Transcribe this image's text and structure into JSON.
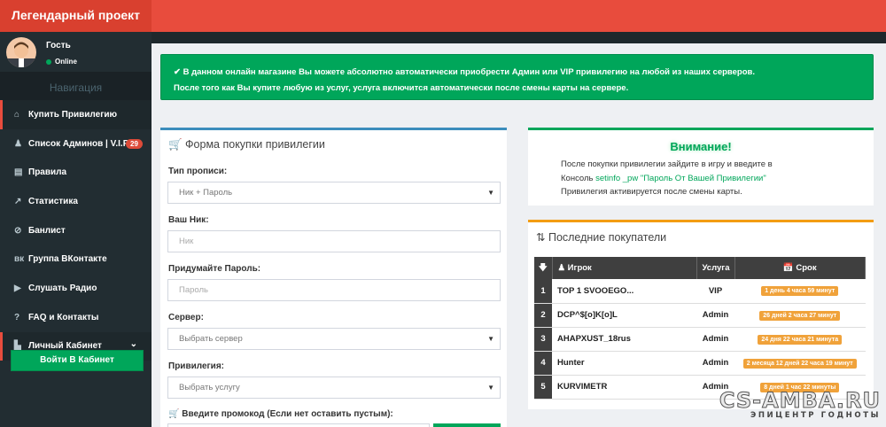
{
  "brand": "Легендарный проект",
  "user": {
    "name": "Гость",
    "status": "Online"
  },
  "sidebar": {
    "nav_header": "Навигация",
    "items": [
      {
        "icon": "home-icon",
        "glyph": "⌂",
        "label": "Купить Привилегию"
      },
      {
        "icon": "user-icon",
        "glyph": "♟",
        "label": "Список Админов | V.I.P",
        "badge": "29"
      },
      {
        "icon": "book-icon",
        "glyph": "▤",
        "label": "Правила"
      },
      {
        "icon": "chart-icon",
        "glyph": "↗",
        "label": "Статистика"
      },
      {
        "icon": "ban-icon",
        "glyph": "⊘",
        "label": "Банлист"
      },
      {
        "icon": "vk-icon",
        "glyph": "вк",
        "label": "Группа ВКонтакте"
      },
      {
        "icon": "play-icon",
        "glyph": "▶",
        "label": "Слушать Радио"
      },
      {
        "icon": "question-icon",
        "glyph": "?",
        "label": "FAQ и Контакты"
      },
      {
        "icon": "cabinet-icon",
        "glyph": "▙",
        "label": "Личный Кабинет"
      }
    ],
    "cabinet_button": "Войти В Кабинет"
  },
  "alert": {
    "line1": "✔ В данном онлайн магазине Вы можете абсолютно автоматически приобрести Админ или VIP привилегию на любой из наших серверов.",
    "line2": "После того как Вы купите любую из услуг, услуга включится автоматически после смены карты на сервере."
  },
  "form": {
    "title": "Форма покупки привилегии",
    "type_label": "Тип прописи:",
    "type_value": "Ник + Пароль",
    "nick_label": "Ваш Ник:",
    "nick_placeholder": "Ник",
    "pass_label": "Придумайте Пароль:",
    "pass_placeholder": "Пароль",
    "server_label": "Сервер:",
    "server_value": "Выбрать сервер",
    "priv_label": "Привилегия:",
    "priv_value": "Выбрать услугу",
    "promo_label": "Введите промокод (Если нет оставить пустым):"
  },
  "attention": {
    "title": "Внимание!",
    "line1": "После покупки привилегии зайдите в игру и введите в",
    "line2_prefix": "Консоль ",
    "line2_cmd": "setinfo _pw \"Пароль От Вашей Привилегии\"",
    "line3": "Привилегия активируется после смены карты."
  },
  "buyers": {
    "title": "Последние покупатели",
    "headers": {
      "player": "Игрок",
      "service": "Услуга",
      "term": "Срок"
    },
    "rows": [
      {
        "n": "1",
        "player": "TOP 1 SVOOEGO...",
        "service": "VIP",
        "term": "1 день 4 часа 59 минут"
      },
      {
        "n": "2",
        "player": "DCP^$[o]K[o]L",
        "service": "Admin",
        "term": "26 дней 2 часа 27 минут"
      },
      {
        "n": "3",
        "player": "AHAPXUST_18rus",
        "service": "Admin",
        "term": "24 дня 22 часа 21 минута"
      },
      {
        "n": "4",
        "player": "Hunter",
        "service": "Admin",
        "term": "2 месяца 12 дней 22 часа 19 минут"
      },
      {
        "n": "5",
        "player": "KURVIMETR",
        "service": "Admin",
        "term": "8 дней 1 час 22 минуты"
      }
    ]
  },
  "watermark": {
    "line1": "CS-AMBA.RU",
    "line2": "ЭПИЦЕНТР ГОДНОТЫ"
  }
}
